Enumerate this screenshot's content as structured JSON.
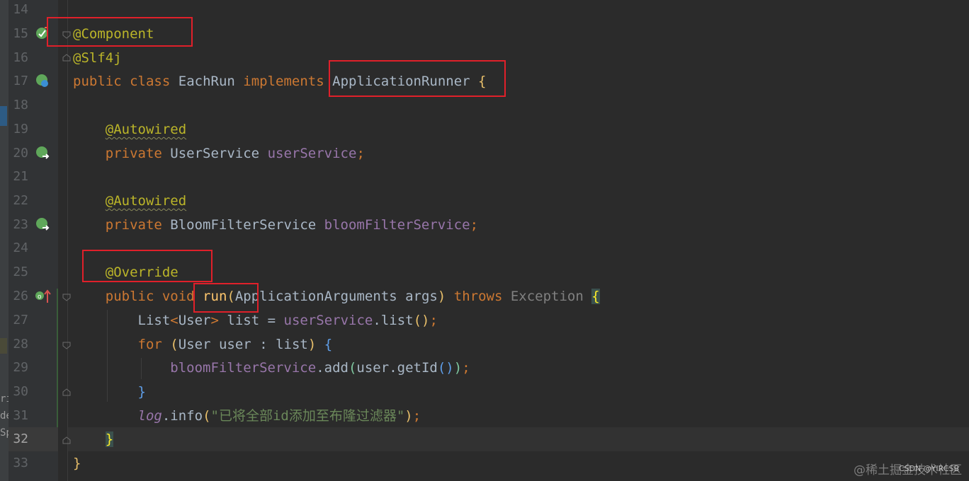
{
  "editor": {
    "lines": [
      {
        "num": "14"
      },
      {
        "num": "15"
      },
      {
        "num": "16"
      },
      {
        "num": "17"
      },
      {
        "num": "18"
      },
      {
        "num": "19"
      },
      {
        "num": "20"
      },
      {
        "num": "21"
      },
      {
        "num": "22"
      },
      {
        "num": "23"
      },
      {
        "num": "24"
      },
      {
        "num": "25"
      },
      {
        "num": "26"
      },
      {
        "num": "27"
      },
      {
        "num": "28"
      },
      {
        "num": "29"
      },
      {
        "num": "30"
      },
      {
        "num": "31"
      },
      {
        "num": "32"
      },
      {
        "num": "33"
      }
    ],
    "tokens": {
      "component": "@Component",
      "slf4j": "@Slf4j",
      "public": "public",
      "class": "class",
      "class_name": "EachRun",
      "implements": "implements",
      "runner": "ApplicationRunner",
      "open_brace": "{",
      "autowired": "@Autowired",
      "private": "private",
      "user_service_type": "UserService",
      "user_service_field": "userService",
      "semicolon": ";",
      "bloom_type": "BloomFilterService",
      "bloom_field": "bloomFilterService",
      "override": "@Override",
      "void": "void",
      "run": "run",
      "open_paren": "(",
      "args_type": "ApplicationArguments",
      "args": "args",
      "close_paren": ")",
      "throws": "throws",
      "exception": "Exception",
      "list_type": "List",
      "lt": "<",
      "user_type": "User",
      "gt": ">",
      "list_var": "list",
      "assign": "=",
      "dot": ".",
      "list_call": "list",
      "parens": "()",
      "for": "for",
      "user_var": "user",
      "colon": ":",
      "add_call": "add",
      "get_id": "getId",
      "close_brace": "}",
      "log": "log",
      "info": "info",
      "message": "\"已将全部id添加至布隆过滤器\""
    },
    "side_strip": [
      "ri",
      "de",
      "Sp"
    ]
  },
  "watermark": {
    "main": "@稀土掘金技术社区",
    "sub": "CSDN @YIRCSB"
  },
  "colors": {
    "background": "#2b2b2b",
    "keyword": "#cc7832",
    "annotation": "#bbb529",
    "field": "#9876aa",
    "string": "#6a8759",
    "method": "#ffc66d",
    "highlight_box": "#e0202a"
  }
}
